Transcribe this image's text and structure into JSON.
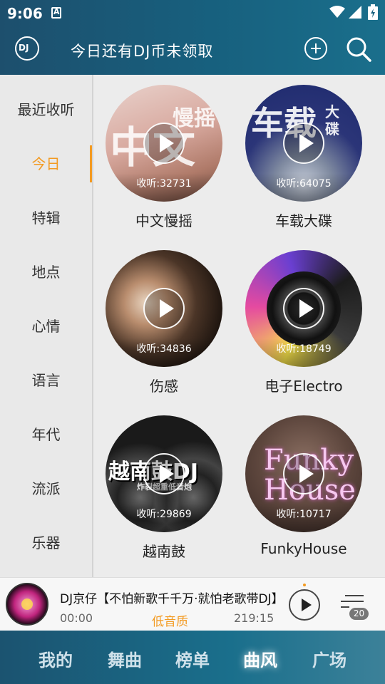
{
  "status_bar": {
    "time": "9:06"
  },
  "header": {
    "title": "今日还有DJ币未领取",
    "logo_text": "DJ"
  },
  "sidebar": {
    "items": [
      {
        "label": "最近收听"
      },
      {
        "label": "今日",
        "active": true
      },
      {
        "label": "特辑"
      },
      {
        "label": "地点"
      },
      {
        "label": "心情"
      },
      {
        "label": "语言"
      },
      {
        "label": "年代"
      },
      {
        "label": "流派"
      },
      {
        "label": "乐器"
      }
    ]
  },
  "tiles": [
    {
      "name": "中文慢摇",
      "count": "收听:32731",
      "art_text": "中文",
      "art_sub": "慢摇"
    },
    {
      "name": "车载大碟",
      "count": "收听:64075",
      "art_text": "车载",
      "art_sub": "大碟"
    },
    {
      "name": "伤感",
      "count": "收听:34836"
    },
    {
      "name": "电子Electro",
      "count": "收听:18749"
    },
    {
      "name": "越南鼓",
      "count": "收听:29869",
      "art_text": "越南鼓DJ",
      "art_sub": "炸裂超重低音炮"
    },
    {
      "name": "FunkyHouse",
      "count": "收听:10717",
      "art_text": "Funky",
      "art_sub": "House"
    }
  ],
  "player": {
    "song": "DJ京仔【不怕新歌千千万·就怕老歌带DJ】",
    "time_elapsed": "00:00",
    "quality": "低音质",
    "time_total": "219:15",
    "queue_count": "20"
  },
  "tabs": [
    {
      "label": "我的"
    },
    {
      "label": "舞曲"
    },
    {
      "label": "榜单"
    },
    {
      "label": "曲风",
      "active": true
    },
    {
      "label": "广场"
    }
  ],
  "colors": {
    "accent": "#f39a21",
    "header": "#17607e"
  }
}
